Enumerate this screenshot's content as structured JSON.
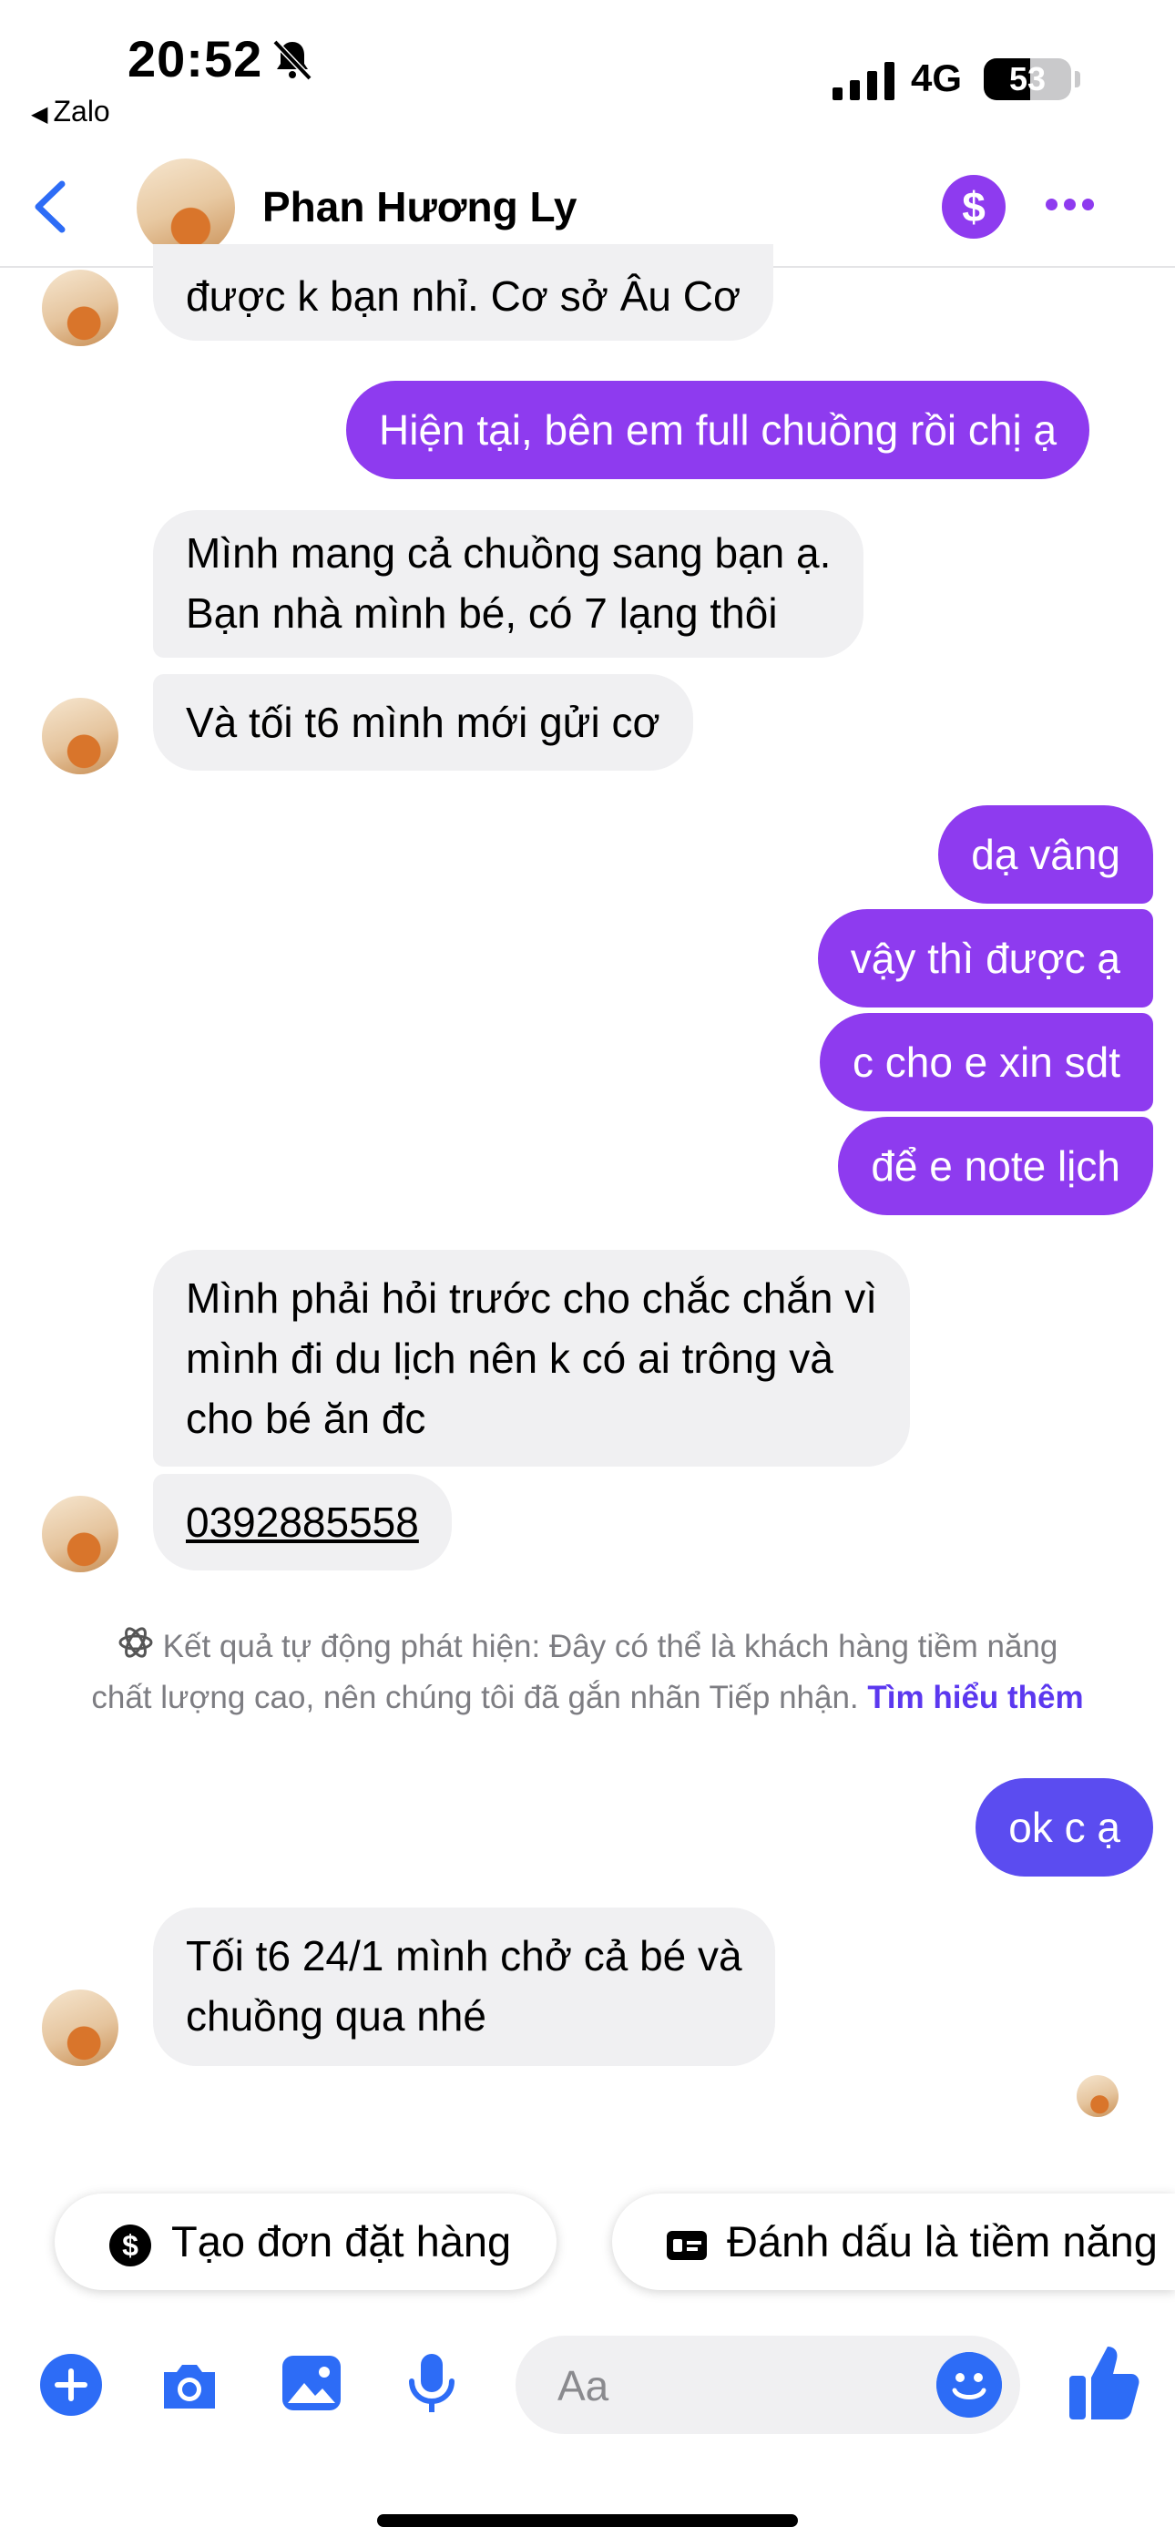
{
  "status_bar": {
    "time": "20:52",
    "back_app": "Zalo",
    "network": "4G",
    "battery": "53",
    "battery_level_percent": 53
  },
  "header": {
    "contact_name": "Phan Hương Ly",
    "accent_color": "#8e3bef"
  },
  "messages": [
    {
      "side": "in",
      "text": "được k bạn nhỉ. Cơ sở Âu Cơ"
    },
    {
      "side": "out",
      "text": "Hiện tại, bên em full chuồng rồi chị ạ"
    },
    {
      "side": "in",
      "line1": "Mình mang cả chuồng sang bạn ạ.",
      "line2": "Bạn nhà mình bé, có 7 lạng thôi"
    },
    {
      "side": "in",
      "text": "Và tối t6 mình mới gửi cơ"
    },
    {
      "side": "out",
      "text": "dạ vâng"
    },
    {
      "side": "out",
      "text": "vậy thì được ạ"
    },
    {
      "side": "out",
      "text": "c cho e xin sdt"
    },
    {
      "side": "out",
      "text": "để e note lịch"
    },
    {
      "side": "in",
      "line1": "Mình phải hỏi trước cho chắc chắn vì",
      "line2": "mình đi du lịch nên k có ai trông và",
      "line3": "cho bé ăn đc"
    },
    {
      "side": "in",
      "text": "0392885558"
    },
    {
      "side": "out",
      "text": "ok c ạ"
    },
    {
      "side": "in",
      "line1": "Tối t6 24/1 mình chở cả bé và",
      "line2": "chuồng qua nhé"
    }
  ],
  "system_note": {
    "line1": "Kết quả tự động phát hiện: Đây có thể là khách hàng tiềm năng",
    "line2": "chất lượng cao, nên chúng tôi đã gắn nhãn Tiếp nhận.",
    "link": "Tìm hiểu thêm"
  },
  "quick_actions": [
    {
      "label": "Tạo đơn đặt hàng",
      "icon": "dollar-circle-icon"
    },
    {
      "label": "Đánh dấu là tiềm năng",
      "icon": "id-card-icon"
    }
  ],
  "composer": {
    "placeholder": "Aa",
    "icons": [
      "plus-icon",
      "camera-icon",
      "image-icon",
      "mic-icon",
      "emoji-icon",
      "thumbs-up-icon"
    ],
    "icon_color": "#2d6cf6"
  }
}
